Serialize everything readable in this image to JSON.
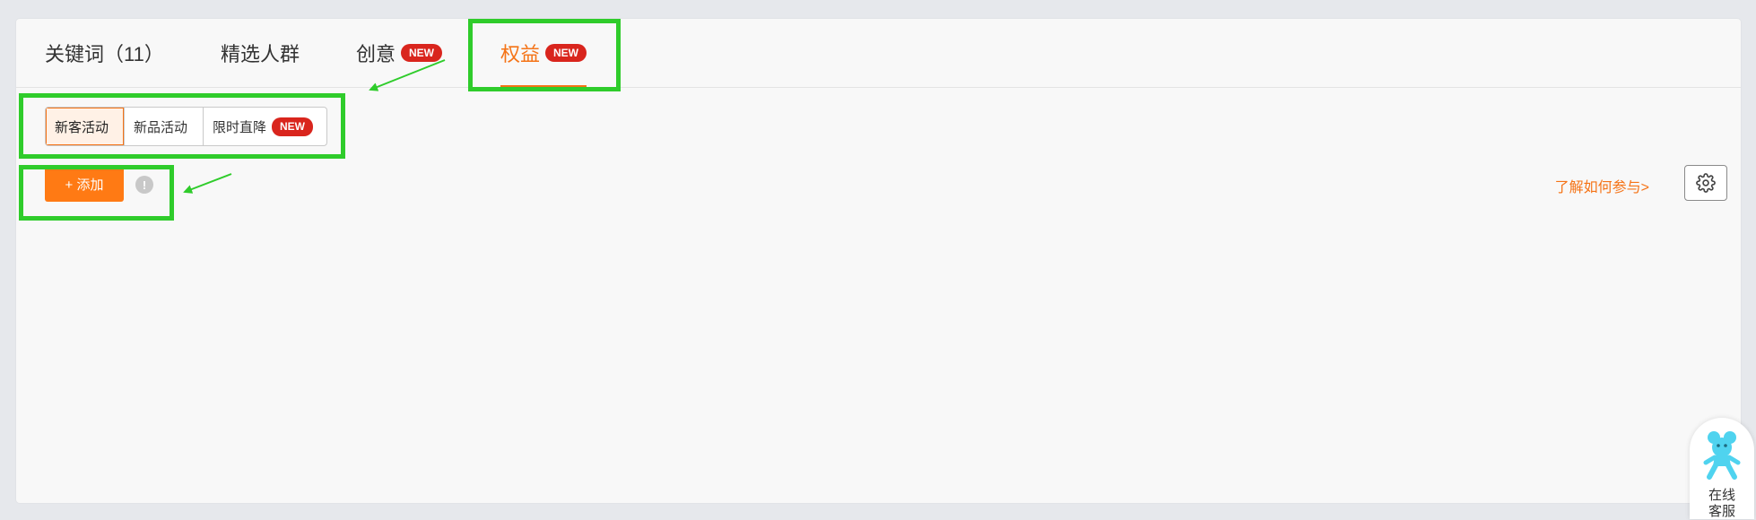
{
  "tabs": [
    {
      "label": "关键词（11）",
      "badge": ""
    },
    {
      "label": "精选人群",
      "badge": ""
    },
    {
      "label": "创意",
      "badge": "NEW"
    },
    {
      "label": "权益",
      "badge": "NEW",
      "active": true
    }
  ],
  "segments": [
    {
      "label": "新客活动",
      "active": true
    },
    {
      "label": "新品活动"
    },
    {
      "label": "限时直降",
      "badge": "NEW"
    }
  ],
  "toolbar": {
    "add_label": "+ 添加",
    "info_glyph": "!",
    "learn_link": "了解如何参与>",
    "settings_icon": "gear-icon"
  },
  "customer_service": {
    "line1": "在线",
    "line2": "客服"
  },
  "colors": {
    "accent": "#f57316",
    "badge": "#d9251d",
    "highlight": "#2fcc2b"
  }
}
